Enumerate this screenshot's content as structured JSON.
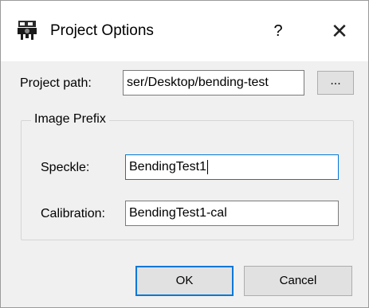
{
  "window": {
    "title": "Project Options",
    "help_label": "?",
    "close_label": "✕",
    "icon": "projector-camera-icon"
  },
  "project_path": {
    "label": "Project path:",
    "value": "ser/Desktop/bending-test",
    "browse_label": "..."
  },
  "image_prefix": {
    "group_title": "Image Prefix",
    "speckle_label": "Speckle:",
    "speckle_value": "BendingTest1",
    "calibration_label": "Calibration:",
    "calibration_value": "BendingTest1-cal"
  },
  "buttons": {
    "ok_label": "OK",
    "cancel_label": "Cancel"
  },
  "colors": {
    "focus_border": "#0078d7",
    "dialog_background": "#f0f0f0"
  }
}
